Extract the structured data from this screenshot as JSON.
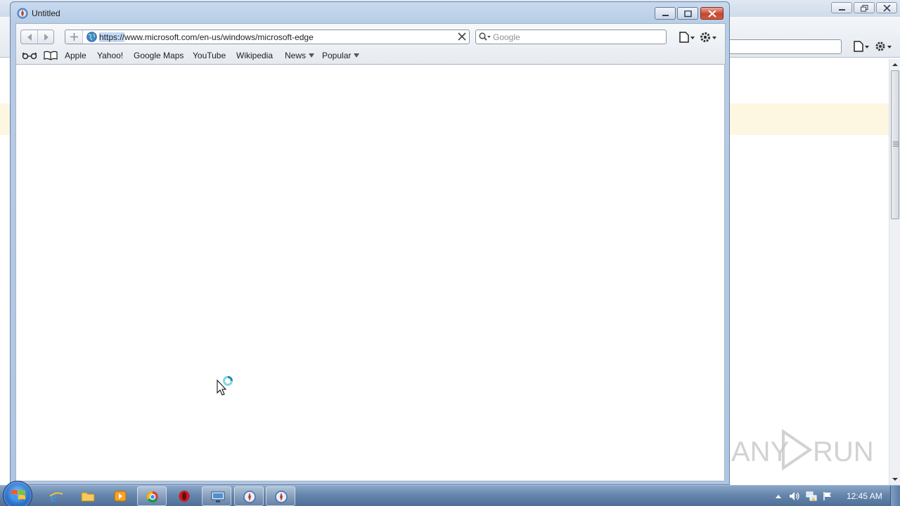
{
  "window": {
    "title": "Untitled",
    "icon": "safari-compass-icon"
  },
  "toolbar": {
    "address": {
      "url_selected": "https://",
      "url_rest": "www.microsoft.com/en-us/windows/microsoft-edge"
    },
    "search": {
      "placeholder": "Google"
    }
  },
  "bookmarks": {
    "items": [
      {
        "label": "Apple"
      },
      {
        "label": "Yahoo!"
      },
      {
        "label": "Google Maps"
      },
      {
        "label": "YouTube"
      },
      {
        "label": "Wikipedia"
      },
      {
        "label": "News"
      },
      {
        "label": "Popular"
      }
    ]
  },
  "watermark": {
    "left": "ANY",
    "right": "RUN"
  },
  "taskbar": {
    "apps": [
      {
        "icon": "internet-explorer-icon"
      },
      {
        "icon": "folder-icon"
      },
      {
        "icon": "media-player-icon"
      },
      {
        "icon": "chrome-icon"
      },
      {
        "icon": "opera-icon"
      },
      {
        "icon": "remote-desktop-icon"
      },
      {
        "icon": "safari-icon"
      },
      {
        "icon": "safari-icon"
      }
    ],
    "clock": "12:45 AM"
  },
  "colors": {
    "accent": "#c3d9f5",
    "close_button": "#c6452f",
    "notice_bar": "#fdf7e2"
  }
}
